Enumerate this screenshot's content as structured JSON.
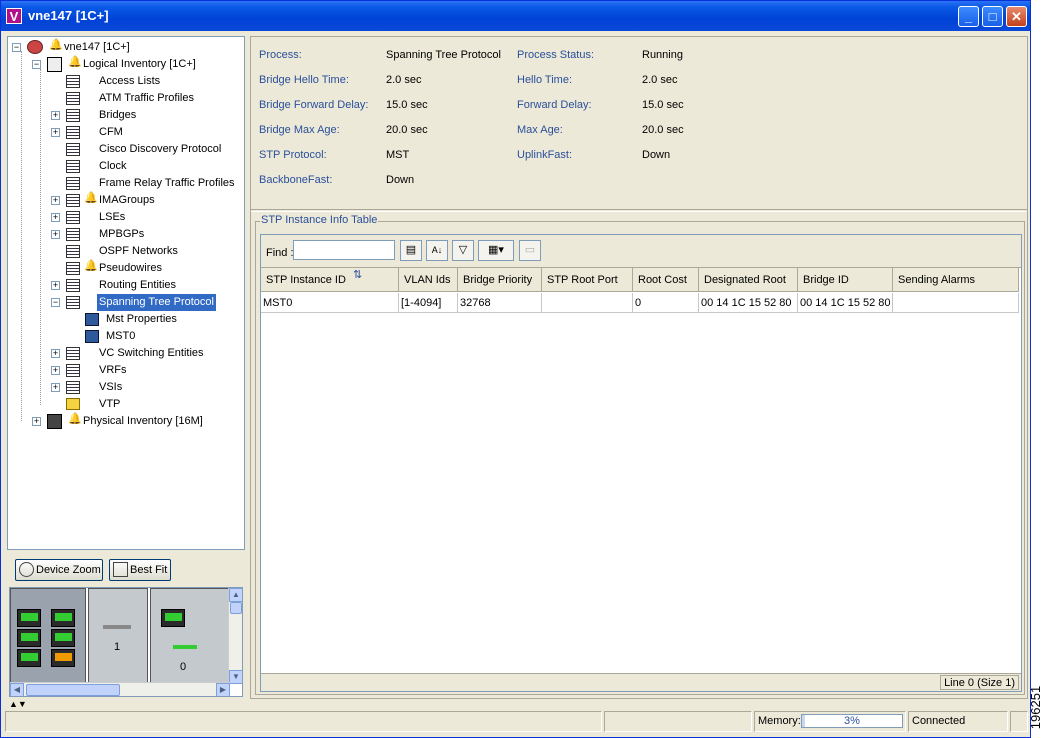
{
  "window": {
    "title": "vne147 [1C+]",
    "icon_letter": "V"
  },
  "tree": {
    "root": "vne147 [1C+]",
    "logical": "Logical Inventory [1C+]",
    "items": [
      "Access Lists",
      "ATM Traffic Profiles",
      "Bridges",
      "CFM",
      "Cisco Discovery Protocol",
      "Clock",
      "Frame Relay Traffic Profiles",
      "IMAGroups",
      "LSEs",
      "MPBGPs",
      "OSPF Networks",
      "Pseudowires",
      "Routing Entities",
      "Spanning Tree Protocol"
    ],
    "stp_children": [
      "Mst Properties",
      "MST0"
    ],
    "items_after": [
      "VC Switching Entities",
      "VRFs",
      "VSIs",
      "VTP"
    ],
    "physical": "Physical Inventory [16M]",
    "selected": "Spanning Tree Protocol"
  },
  "zoom": {
    "device_zoom": "Device Zoom",
    "best_fit": "Best Fit",
    "slot_labels": [
      "1",
      "0"
    ]
  },
  "properties": {
    "left": [
      {
        "label": "Process:",
        "value": "Spanning Tree Protocol"
      },
      {
        "label": "Bridge Hello Time:",
        "value": "2.0 sec"
      },
      {
        "label": "Bridge Forward Delay:",
        "value": "15.0 sec"
      },
      {
        "label": "Bridge Max Age:",
        "value": "20.0 sec"
      },
      {
        "label": "STP Protocol:",
        "value": "MST"
      },
      {
        "label": "BackboneFast:",
        "value": "Down"
      }
    ],
    "right": [
      {
        "label": "Process Status:",
        "value": "Running"
      },
      {
        "label": "Hello Time:",
        "value": "2.0 sec"
      },
      {
        "label": "Forward Delay:",
        "value": "15.0 sec"
      },
      {
        "label": "Max Age:",
        "value": "20.0 sec"
      },
      {
        "label": "UplinkFast:",
        "value": "Down"
      }
    ]
  },
  "table": {
    "group_title": "STP Instance Info Table",
    "find_label": "Find :",
    "find_value": "",
    "columns": [
      "STP Instance ID",
      "VLAN Ids",
      "Bridge Priority",
      "STP Root Port",
      "Root Cost",
      "Designated Root",
      "Bridge ID",
      "Sending Alarms"
    ],
    "rows": [
      [
        "MST0",
        "[1-4094]",
        "32768",
        "",
        "0",
        "00 14 1C 15 52 80",
        "00 14 1C 15 52 80",
        ""
      ]
    ],
    "footer": "Line 0 (Size 1)"
  },
  "status": {
    "memory_label": "Memory:",
    "memory_value": "3%",
    "memory_fraction": 0.03,
    "connection": "Connected"
  },
  "figure_id": "196251"
}
